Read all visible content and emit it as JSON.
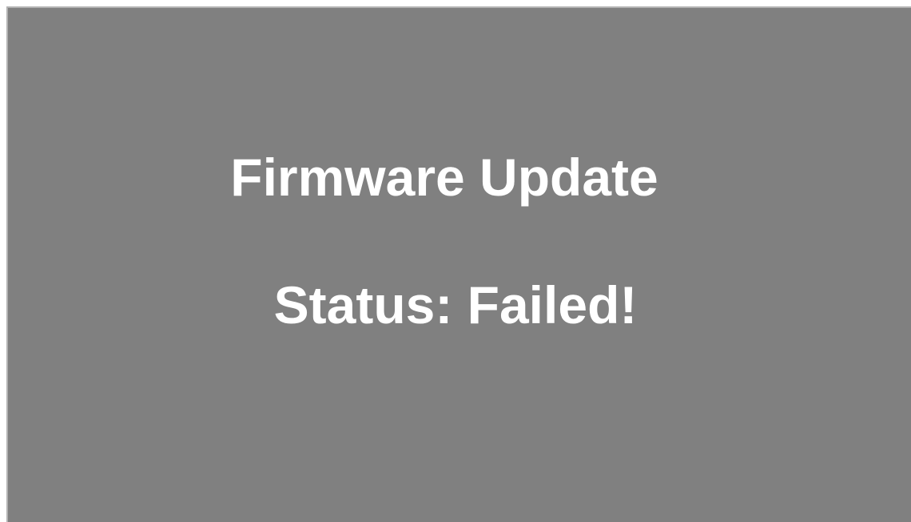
{
  "screen": {
    "title": "Firmware Update",
    "status": "Status: Failed!",
    "background_color": "#808080",
    "text_color": "#ffffff"
  }
}
